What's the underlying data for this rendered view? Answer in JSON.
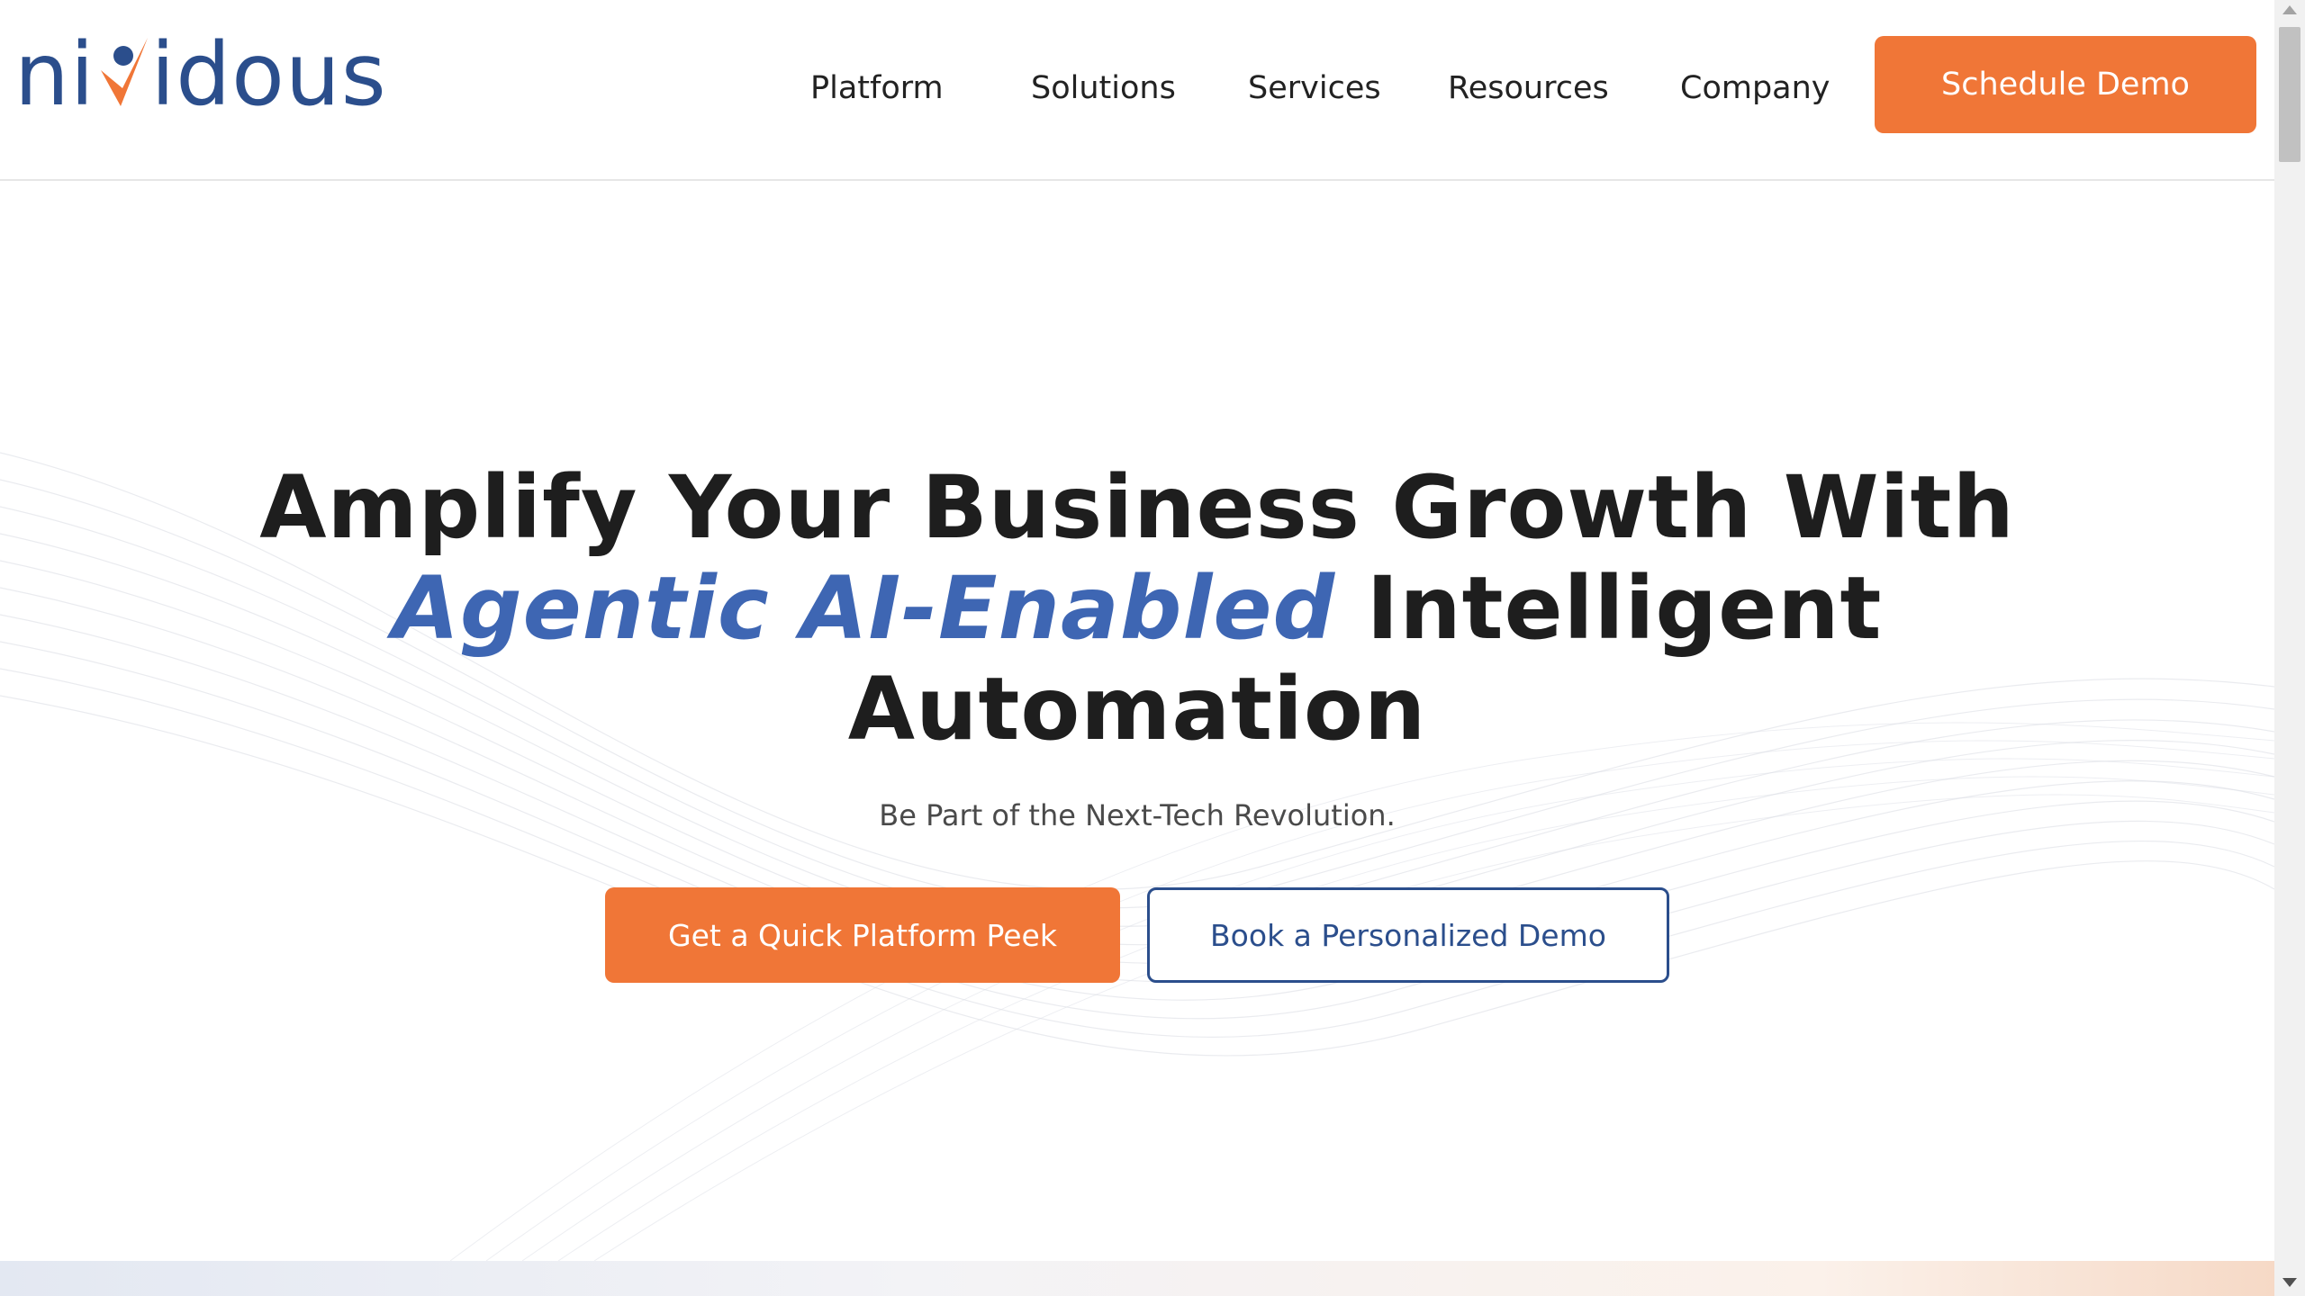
{
  "brand": {
    "logo_prefix": "ni",
    "logo_suffix": "idous",
    "primary_color": "#2b4e8c",
    "accent_color": "#f07637"
  },
  "nav": {
    "items": [
      {
        "label": "Platform"
      },
      {
        "label": "Solutions"
      },
      {
        "label": "Services"
      },
      {
        "label": "Resources"
      },
      {
        "label": "Company"
      }
    ],
    "cta_label": "Schedule Demo"
  },
  "hero": {
    "title_line1": "Amplify Your Business Growth With",
    "title_accent_a": "Agentic ",
    "title_accent_b": "AI-Enabled",
    "title_line2_rest": " Intelligent",
    "title_line3": "Automation",
    "subtitle": "Be Part of the Next-Tech Revolution.",
    "primary_button": "Get a Quick Platform Peek",
    "secondary_button": "Book a Personalized Demo"
  },
  "icons": {
    "logo_mark": "checkmark-icon",
    "scroll_up": "arrow-up-icon",
    "scroll_down": "arrow-down-icon"
  }
}
